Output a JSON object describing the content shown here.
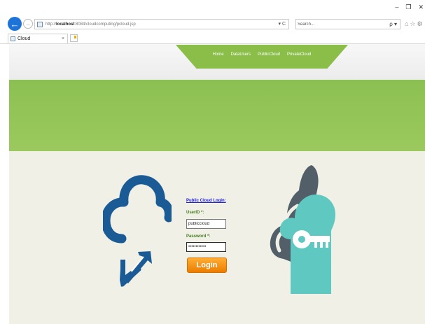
{
  "browser": {
    "url_prefix": "http://",
    "url_host": "localhost",
    "url_path": ":8084/cloudcomputing/pcloud.jsp",
    "url_tools": "▾ C",
    "search_placeholder": "Search...",
    "search_tools": "ρ ▾",
    "window_controls": {
      "minimize": "–",
      "restore": "❐",
      "close": "✕"
    },
    "tab_title": "Cloud",
    "tab_close": "×"
  },
  "nav": {
    "items": [
      {
        "label": "Home"
      },
      {
        "label": "DataUsers"
      },
      {
        "label": "PublicCloud"
      },
      {
        "label": "PrivateCloud"
      }
    ]
  },
  "login": {
    "title": "Public Cloud Login:",
    "userid_label": "UserID *:",
    "userid_value": "publiccloud",
    "password_label": "Password *:",
    "password_value": "publiccloud1",
    "button_label": "Login"
  },
  "colors": {
    "accent_green": "#8abe48",
    "login_button": "#f08a00",
    "left_cloud": "#1a5b95",
    "right_cloud_dark": "#525e68",
    "right_cloud_teal": "#5fc8c0"
  },
  "icons": {
    "left": "cloud-upload-download-icon",
    "right": "cloud-key-icon"
  }
}
